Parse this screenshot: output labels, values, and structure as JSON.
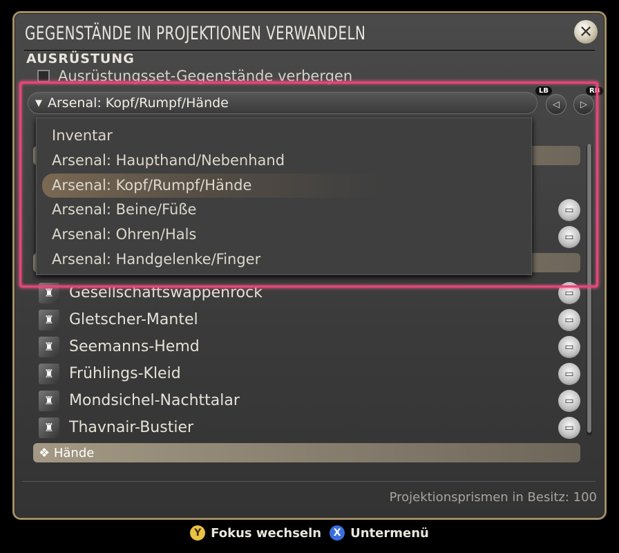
{
  "window": {
    "title": "GEGENSTÄNDE IN PROJEKTIONEN VERWANDELN",
    "close_icon": "close-icon"
  },
  "section": {
    "label": "AUSRÜSTUNG",
    "hide_set_items_label": "Ausrüstungsset-Gegenstände verbergen",
    "hide_set_items_checked": false
  },
  "category": {
    "selected": "Arsenal: Kopf/Rumpf/Hände",
    "lb_label": "LB",
    "rb_label": "RB",
    "options": [
      "Inventar",
      "Arsenal: Haupthand/Nebenhand",
      "Arsenal: Kopf/Rumpf/Hände",
      "Arsenal: Beine/Füße",
      "Arsenal: Ohren/Hals",
      "Arsenal: Handgelenke/Finger"
    ]
  },
  "list": {
    "items": [
      {
        "name": "Gesellschaftswappenrock"
      },
      {
        "name": "Gletscher-Mantel"
      },
      {
        "name": "Seemanns-Hemd"
      },
      {
        "name": "Frühlings-Kleid"
      },
      {
        "name": "Mondsichel-Nachttalar"
      },
      {
        "name": "Thavnair-Bustier"
      }
    ],
    "hands_header": "❖ Hände"
  },
  "footer": {
    "prism_count_text": "Projektionsprismen in Besitz: 100"
  },
  "hints": {
    "y_label": "Y",
    "y_text": "Fokus wechseln",
    "x_label": "X",
    "x_text": "Untermenü"
  },
  "colors": {
    "focus_frame": "#e5457a",
    "frame_gold": "#a08e6a",
    "y_button": "#e9c246",
    "x_button": "#3a6ee0"
  }
}
